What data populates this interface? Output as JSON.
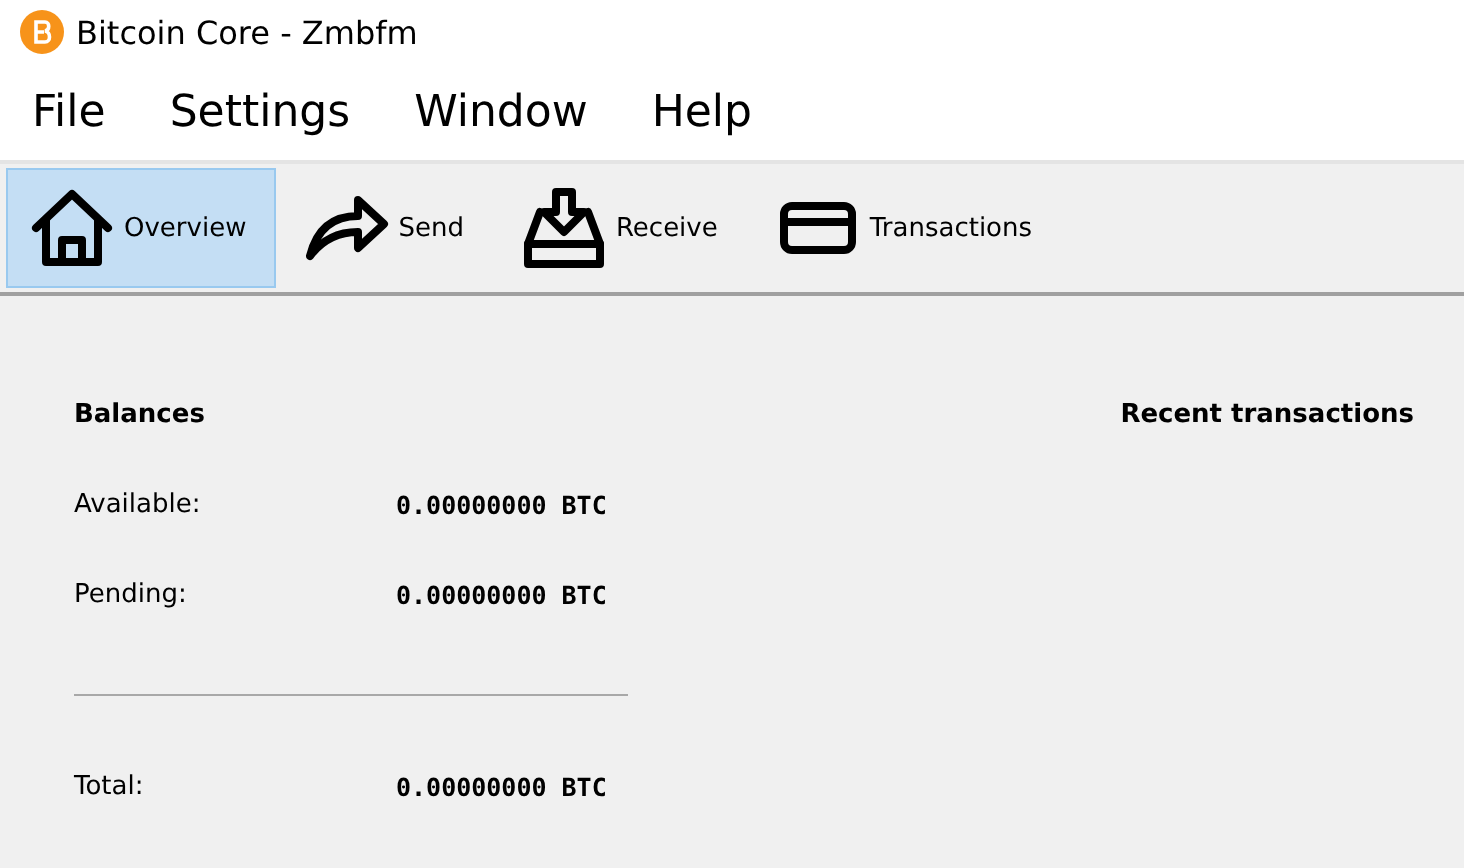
{
  "window": {
    "title": "Bitcoin Core - Zmbfm"
  },
  "menu": [
    "File",
    "Settings",
    "Window",
    "Help"
  ],
  "toolbar": [
    {
      "label": "Overview",
      "kind": "house",
      "selected": true
    },
    {
      "label": "Send",
      "kind": "arrow",
      "selected": false
    },
    {
      "label": "Receive",
      "kind": "inbox",
      "selected": false
    },
    {
      "label": "Transactions",
      "kind": "card",
      "selected": false
    }
  ],
  "balances": {
    "title": "Balances",
    "rows": [
      {
        "label": "Available:",
        "value": "0.00000000 BTC"
      },
      {
        "label": "Pending:",
        "value": "0.00000000 BTC"
      },
      {
        "label": "Total:",
        "value": "0.00000000 BTC"
      }
    ]
  },
  "recent": {
    "title": "Recent transactions"
  }
}
